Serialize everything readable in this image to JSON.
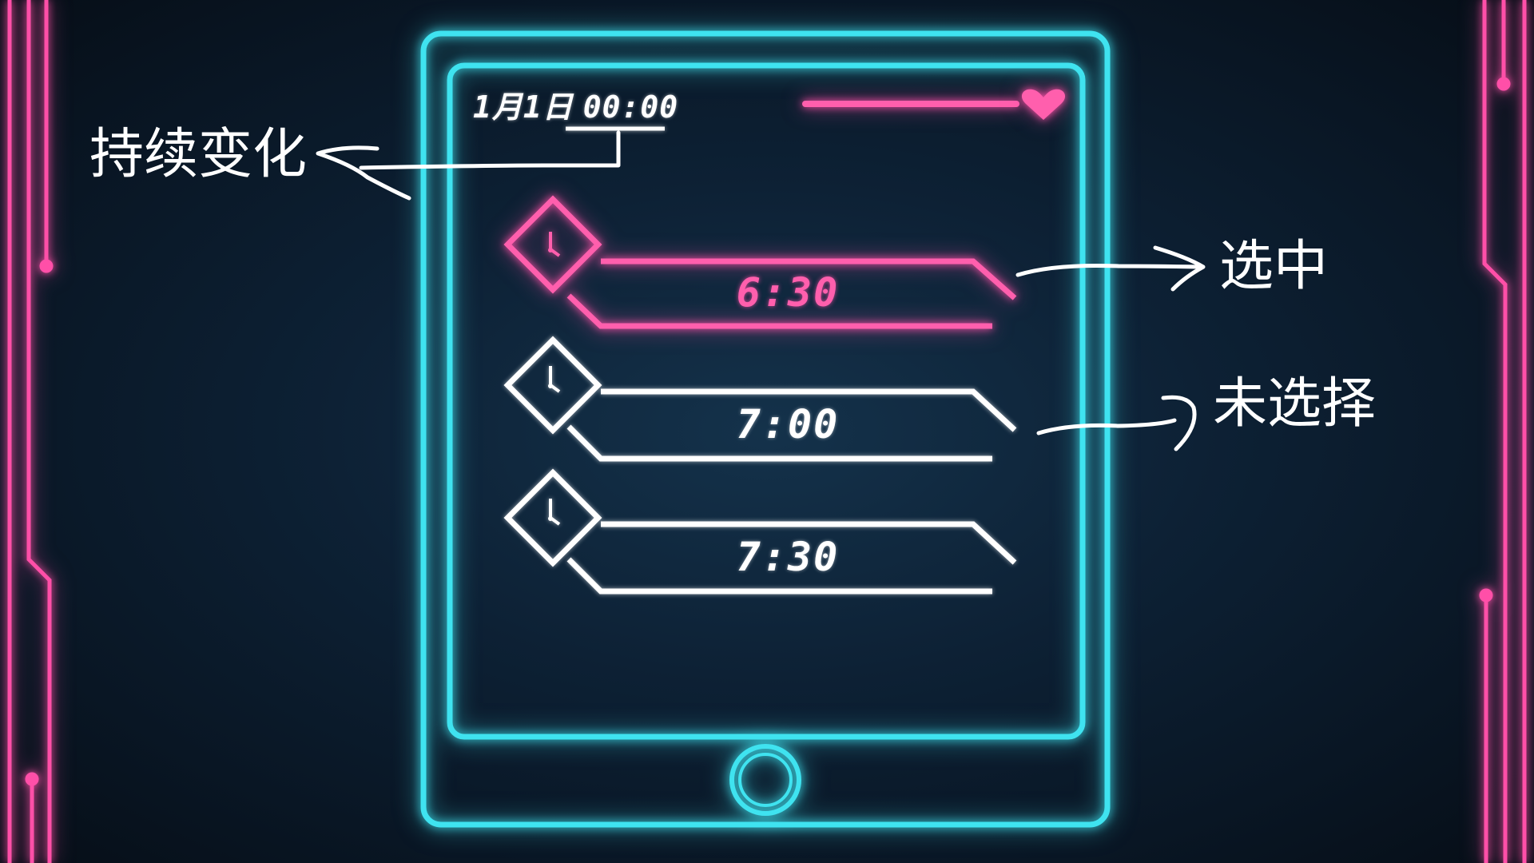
{
  "colors": {
    "cyan": "#3fe3f0",
    "pink": "#ff5fad",
    "white": "#ffffff",
    "background": "#0d2135"
  },
  "header": {
    "date": "1月1日",
    "time": "00:00",
    "icon": "heart-icon"
  },
  "alarms": [
    {
      "time": "6:30",
      "state": "selected",
      "icon": "clock-icon"
    },
    {
      "time": "7:00",
      "state": "unselected",
      "icon": "clock-icon"
    },
    {
      "time": "7:30",
      "state": "unselected",
      "icon": "clock-icon"
    }
  ],
  "annotations": {
    "continuous_change": "持续变化",
    "selected": "选中",
    "unselected": "未选择"
  }
}
